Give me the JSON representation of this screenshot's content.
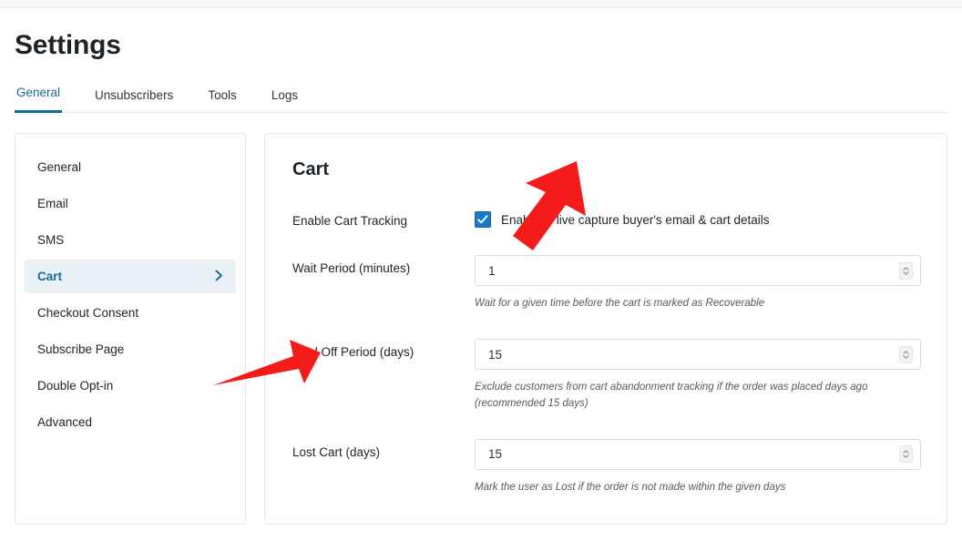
{
  "page": {
    "title": "Settings"
  },
  "tabs": [
    {
      "label": "General",
      "active": true
    },
    {
      "label": "Unsubscribers",
      "active": false
    },
    {
      "label": "Tools",
      "active": false
    },
    {
      "label": "Logs",
      "active": false
    }
  ],
  "sidebar": {
    "items": [
      {
        "label": "General",
        "active": false
      },
      {
        "label": "Email",
        "active": false
      },
      {
        "label": "SMS",
        "active": false
      },
      {
        "label": "Cart",
        "active": true,
        "chevron": "chevron-right"
      },
      {
        "label": "Checkout Consent",
        "active": false
      },
      {
        "label": "Subscribe Page",
        "active": false
      },
      {
        "label": "Double Opt-in",
        "active": false
      },
      {
        "label": "Advanced",
        "active": false
      }
    ]
  },
  "main": {
    "section_title": "Cart",
    "fields": {
      "enable_cart_tracking": {
        "label": "Enable Cart Tracking",
        "checkbox_checked": true,
        "checkbox_text": "Enable to live capture buyer's email & cart details"
      },
      "wait_period": {
        "label": "Wait Period (minutes)",
        "value": "1",
        "helper": "Wait for a given time before the cart is marked as Recoverable"
      },
      "cool_off_period": {
        "label": "Cool Off Period (days)",
        "value": "15",
        "helper": "Exclude customers from cart abandonment tracking if the order was placed days ago (recommended 15 days)"
      },
      "lost_cart": {
        "label": "Lost Cart (days)",
        "value": "15",
        "helper": "Mark the user as Lost if the order is not made within the given days"
      }
    }
  },
  "annotations": [
    {
      "name": "arrow-pointing-to-checkbox",
      "direction": "down-left",
      "color": "#f41b1b"
    },
    {
      "name": "arrow-pointing-to-cart-nav-item",
      "direction": "up-right",
      "color": "#f41b1b"
    }
  ],
  "colors": {
    "accent": "#1a6b96",
    "checkbox_blue": "#1e78c8",
    "nav_active_bg": "#e9f1f6",
    "annotation_red": "#f41b1b",
    "border": "#e6e8ea"
  }
}
